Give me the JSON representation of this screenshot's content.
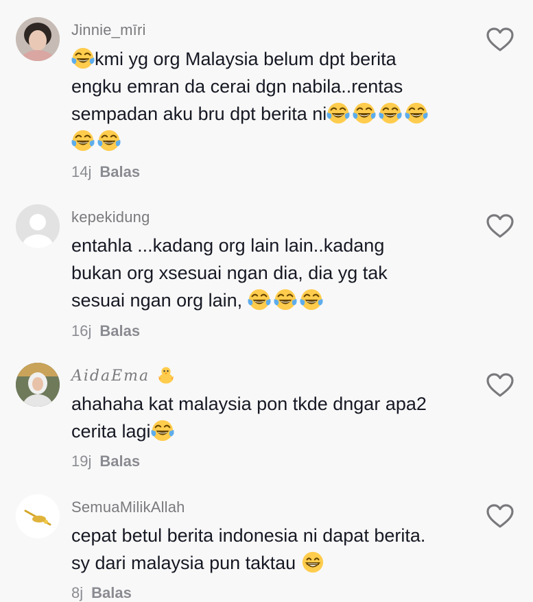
{
  "icons": {
    "like": "heart-outline-icon",
    "laugh_emoji": "face-with-tears-of-joy",
    "grin_emoji": "grinning-face-with-smiling-eyes",
    "chick_emoji": "baby-chick"
  },
  "colors": {
    "background": "#f8f8f8",
    "username": "#7a7a7e",
    "text": "#161823",
    "meta": "#8a8b91"
  },
  "comments": [
    {
      "username": "Jinnie_mīri",
      "lines": [
        "kmi yg org Malaysia belum dpt berita",
        "engku emran da cerai dgn nabila..rentas",
        "sempadan aku bru dpt berita ni"
      ],
      "time": "14j",
      "reply_label": "Balas"
    },
    {
      "username": "kepekidung",
      "lines": [
        "entahla ...kadang org lain lain..kadang",
        "bukan org xsesuai ngan dia, dia yg tak",
        "sesuai ngan org lain, "
      ],
      "time": "16j",
      "reply_label": "Balas"
    },
    {
      "username": "AidaEma",
      "lines": [
        "ahahaha kat malaysia pon tkde dngar apa2",
        "cerita lagi"
      ],
      "time": "19j",
      "reply_label": "Balas"
    },
    {
      "username": "SemuaMilikAllah",
      "lines": [
        "cepat betul berita indonesia ni dapat berita.",
        "sy dari malaysia pun taktau "
      ],
      "time": "8j",
      "reply_label": "Balas"
    }
  ]
}
